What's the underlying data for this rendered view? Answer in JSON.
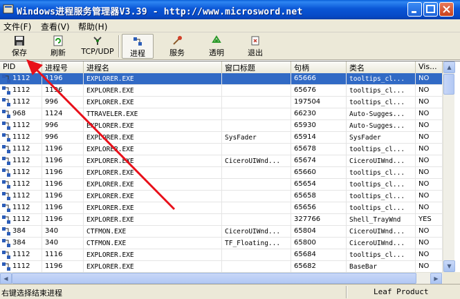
{
  "window": {
    "title": "Windows进程服务管理器V3.39 - http://www.microsword.net"
  },
  "menu": [
    {
      "label": "文件(F)"
    },
    {
      "label": "查看(V)"
    },
    {
      "label": "帮助(H)"
    }
  ],
  "toolbar": {
    "save": "保存",
    "refresh": "刷新",
    "tcpudp": "TCP/UDP",
    "process": "进程",
    "service": "服务",
    "transparent": "透明",
    "exit": "退出"
  },
  "table": {
    "columns": [
      "PID",
      "进程号",
      "进程名",
      "窗口标题",
      "句柄",
      "类名",
      "Vis..."
    ],
    "rows": [
      [
        "1112",
        "1196",
        "EXPLORER.EXE",
        "",
        "65666",
        "tooltips_cl...",
        "NO"
      ],
      [
        "1112",
        "1196",
        "EXPLORER.EXE",
        "",
        "65676",
        "tooltips_cl...",
        "NO"
      ],
      [
        "1112",
        "996",
        "EXPLORER.EXE",
        "",
        "197504",
        "tooltips_cl...",
        "NO"
      ],
      [
        "968",
        "1124",
        "TTRAVELER.EXE",
        "",
        "66230",
        "Auto-Sugges...",
        "NO"
      ],
      [
        "1112",
        "996",
        "EXPLORER.EXE",
        "",
        "65930",
        "Auto-Sugges...",
        "NO"
      ],
      [
        "1112",
        "996",
        "EXPLORER.EXE",
        "SysFader",
        "65914",
        "SysFader",
        "NO"
      ],
      [
        "1112",
        "1196",
        "EXPLORER.EXE",
        "",
        "65678",
        "tooltips_cl...",
        "NO"
      ],
      [
        "1112",
        "1196",
        "EXPLORER.EXE",
        "CiceroUIWnd...",
        "65674",
        "CiceroUIWnd...",
        "NO"
      ],
      [
        "1112",
        "1196",
        "EXPLORER.EXE",
        "",
        "65660",
        "tooltips_cl...",
        "NO"
      ],
      [
        "1112",
        "1196",
        "EXPLORER.EXE",
        "",
        "65654",
        "tooltips_cl...",
        "NO"
      ],
      [
        "1112",
        "1196",
        "EXPLORER.EXE",
        "",
        "65658",
        "tooltips_cl...",
        "NO"
      ],
      [
        "1112",
        "1196",
        "EXPLORER.EXE",
        "",
        "65656",
        "tooltips_cl...",
        "NO"
      ],
      [
        "1112",
        "1196",
        "EXPLORER.EXE",
        "",
        "327766",
        "Shell_TrayWnd",
        "YES"
      ],
      [
        "384",
        "340",
        "CTFMON.EXE",
        "CiceroUIWnd...",
        "65804",
        "CiceroUIWnd...",
        "NO"
      ],
      [
        "384",
        "340",
        "CTFMON.EXE",
        "TF_Floating...",
        "65800",
        "CiceroUIWnd...",
        "NO"
      ],
      [
        "1112",
        "1116",
        "EXPLORER.EXE",
        "",
        "65684",
        "tooltips_cl...",
        "NO"
      ],
      [
        "1112",
        "1196",
        "EXPLORER.EXE",
        "",
        "65682",
        "BaseBar",
        "NO"
      ]
    ],
    "selected_row": 0
  },
  "status": {
    "left": "右键选择结束进程",
    "right": "Leaf Product"
  },
  "colors": {
    "selection": "#316ac5",
    "arrow": "#e8101a"
  }
}
